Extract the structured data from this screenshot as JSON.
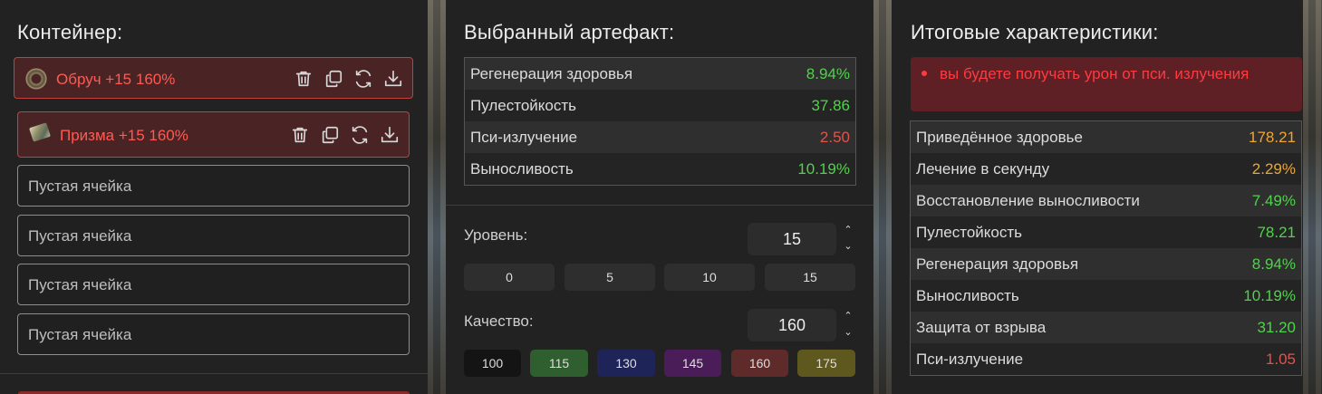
{
  "container": {
    "title": "Контейнер:",
    "slots": [
      {
        "label": "Обруч +15 160%",
        "icon": "ring-artifact-icon",
        "filled": true
      },
      {
        "label": "Призма +15 160%",
        "icon": "prism-artifact-icon",
        "filled": true
      },
      {
        "label": "Пустая ячейка",
        "filled": false
      },
      {
        "label": "Пустая ячейка",
        "filled": false
      },
      {
        "label": "Пустая ячейка",
        "filled": false
      },
      {
        "label": "Пустая ячейка",
        "filled": false
      }
    ],
    "slot_actions": [
      "trash-icon",
      "copy-icon",
      "refresh-icon",
      "download-icon"
    ]
  },
  "selected": {
    "title": "Выбранный артефакт:",
    "stats": [
      {
        "name": "Регенерация здоровья",
        "value": "8.94%",
        "color": "#4fd34a"
      },
      {
        "name": "Пулестойкость",
        "value": "37.86",
        "color": "#4fd34a"
      },
      {
        "name": "Пси-излучение",
        "value": "2.50",
        "color": "#e0544c"
      },
      {
        "name": "Выносливость",
        "value": "10.19%",
        "color": "#4fd34a"
      }
    ],
    "level": {
      "label": "Уровень:",
      "value": "15",
      "presets": [
        "0",
        "5",
        "10",
        "15"
      ]
    },
    "quality": {
      "label": "Качество:",
      "value": "160",
      "presets": [
        {
          "label": "100",
          "color": "#141414"
        },
        {
          "label": "115",
          "color": "#2f5e2f"
        },
        {
          "label": "130",
          "color": "#1e2358"
        },
        {
          "label": "145",
          "color": "#4a1d58"
        },
        {
          "label": "160",
          "color": "#5e2a2a"
        },
        {
          "label": "175",
          "color": "#5e571e"
        }
      ]
    }
  },
  "totals": {
    "title": "Итоговые характеристики:",
    "warning": "вы будете получать урон от пси. излучения",
    "stats": [
      {
        "name": "Приведённое здоровье",
        "value": "178.21",
        "color": "#f0a530"
      },
      {
        "name": "Лечение в секунду",
        "value": "2.29%",
        "color": "#f0a530"
      },
      {
        "name": "Восстановление выносливости",
        "value": "7.49%",
        "color": "#4fd34a"
      },
      {
        "name": "Пулестойкость",
        "value": "78.21",
        "color": "#4fd34a"
      },
      {
        "name": "Регенерация здоровья",
        "value": "8.94%",
        "color": "#4fd34a"
      },
      {
        "name": "Выносливость",
        "value": "10.19%",
        "color": "#4fd34a"
      },
      {
        "name": "Защита от взрыва",
        "value": "31.20",
        "color": "#4fd34a"
      },
      {
        "name": "Пси-излучение",
        "value": "1.05",
        "color": "#e0544c"
      }
    ]
  }
}
